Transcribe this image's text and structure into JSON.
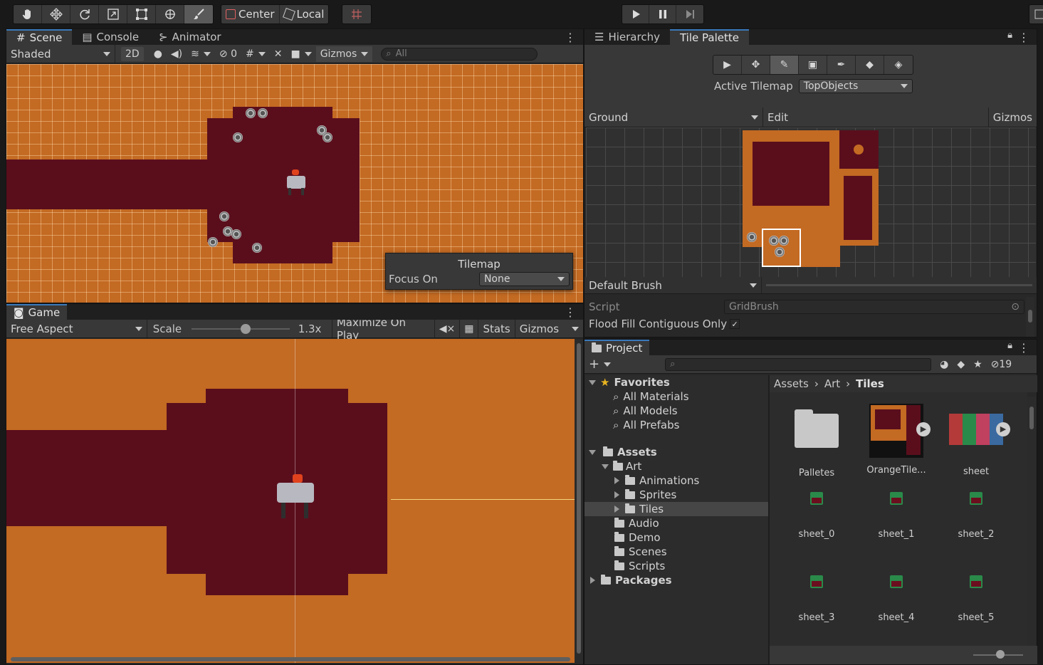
{
  "toolbar": {
    "tools": [
      "hand-tool",
      "move-tool",
      "rotate-tool",
      "scale-tool",
      "rect-tool",
      "transform-tool",
      "custom-tool"
    ],
    "pivot": "Center",
    "space": "Local"
  },
  "scene_panel": {
    "tabs": [
      "Scene",
      "Console",
      "Animator"
    ],
    "shading": "Shaded",
    "mode_2d": "2D",
    "hidden_count": "0",
    "gizmos": "Gizmos",
    "search_placeholder": "All",
    "overlay": {
      "title": "Tilemap",
      "focus_label": "Focus On",
      "focus_value": "None"
    }
  },
  "game_panel": {
    "tab": "Game",
    "aspect": "Free Aspect",
    "scale_label": "Scale",
    "scale_value": "1.3x",
    "maximize": "Maximize On Play",
    "stats": "Stats",
    "gizmos": "Gizmos"
  },
  "tile_palette": {
    "tabs": [
      "Hierarchy",
      "Tile Palette"
    ],
    "active_tilemap_label": "Active Tilemap",
    "active_tilemap_value": "TopObjects",
    "palette": "Ground",
    "edit": "Edit",
    "gizmos": "Gizmos",
    "brush": "Default Brush",
    "script_label": "Script",
    "script_value": "GridBrush",
    "flood_fill_label": "Flood Fill Contiguous Only",
    "flood_fill_checked": true
  },
  "project": {
    "tab": "Project",
    "hidden_count": "19",
    "breadcrumb": [
      "Assets",
      "Art",
      "Tiles"
    ],
    "tree": {
      "favorites": "Favorites",
      "fav_items": [
        "All Materials",
        "All Models",
        "All Prefabs"
      ],
      "assets": "Assets",
      "art": "Art",
      "art_children": [
        "Animations",
        "Sprites",
        "Tiles"
      ],
      "assets_children": [
        "Audio",
        "Demo",
        "Scenes",
        "Scripts"
      ],
      "packages": "Packages"
    },
    "assets": [
      "Palletes",
      "OrangeTile...",
      "sheet",
      "sheet_0",
      "sheet_1",
      "sheet_2",
      "sheet_3",
      "sheet_4",
      "sheet_5"
    ]
  },
  "colors": {
    "ground": "#c36a23",
    "path": "#5a0e1c",
    "accent": "#3a79bb"
  }
}
